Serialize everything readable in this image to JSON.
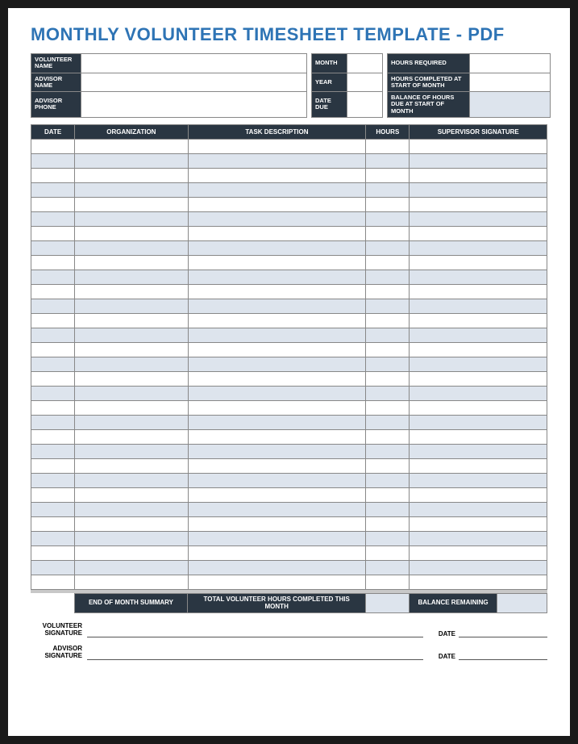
{
  "title": "MONTHLY VOLUNTEER TIMESHEET TEMPLATE - PDF",
  "header": {
    "volunteer_name_label": "VOLUNTEER NAME",
    "advisor_name_label": "ADVISOR NAME",
    "advisor_phone_label": "ADVISOR PHONE",
    "month_label": "MONTH",
    "year_label": "YEAR",
    "date_due_label": "DATE DUE",
    "hours_required_label": "HOURS REQUIRED",
    "hours_completed_label": "HOURS COMPLETED AT START OF MONTH",
    "balance_due_label": "BALANCE OF HOURS DUE AT START OF MONTH",
    "volunteer_name": "",
    "advisor_name": "",
    "advisor_phone": "",
    "month": "",
    "year": "",
    "date_due": "",
    "hours_required": "",
    "hours_completed": "",
    "balance_due": ""
  },
  "columns": {
    "date": "DATE",
    "organization": "ORGANIZATION",
    "task": "TASK DESCRIPTION",
    "hours": "HOURS",
    "signature": "SUPERVISOR SIGNATURE"
  },
  "rows": [
    {
      "date": "",
      "organization": "",
      "task": "",
      "hours": "",
      "signature": ""
    },
    {
      "date": "",
      "organization": "",
      "task": "",
      "hours": "",
      "signature": ""
    },
    {
      "date": "",
      "organization": "",
      "task": "",
      "hours": "",
      "signature": ""
    },
    {
      "date": "",
      "organization": "",
      "task": "",
      "hours": "",
      "signature": ""
    },
    {
      "date": "",
      "organization": "",
      "task": "",
      "hours": "",
      "signature": ""
    },
    {
      "date": "",
      "organization": "",
      "task": "",
      "hours": "",
      "signature": ""
    },
    {
      "date": "",
      "organization": "",
      "task": "",
      "hours": "",
      "signature": ""
    },
    {
      "date": "",
      "organization": "",
      "task": "",
      "hours": "",
      "signature": ""
    },
    {
      "date": "",
      "organization": "",
      "task": "",
      "hours": "",
      "signature": ""
    },
    {
      "date": "",
      "organization": "",
      "task": "",
      "hours": "",
      "signature": ""
    },
    {
      "date": "",
      "organization": "",
      "task": "",
      "hours": "",
      "signature": ""
    },
    {
      "date": "",
      "organization": "",
      "task": "",
      "hours": "",
      "signature": ""
    },
    {
      "date": "",
      "organization": "",
      "task": "",
      "hours": "",
      "signature": ""
    },
    {
      "date": "",
      "organization": "",
      "task": "",
      "hours": "",
      "signature": ""
    },
    {
      "date": "",
      "organization": "",
      "task": "",
      "hours": "",
      "signature": ""
    },
    {
      "date": "",
      "organization": "",
      "task": "",
      "hours": "",
      "signature": ""
    },
    {
      "date": "",
      "organization": "",
      "task": "",
      "hours": "",
      "signature": ""
    },
    {
      "date": "",
      "organization": "",
      "task": "",
      "hours": "",
      "signature": ""
    },
    {
      "date": "",
      "organization": "",
      "task": "",
      "hours": "",
      "signature": ""
    },
    {
      "date": "",
      "organization": "",
      "task": "",
      "hours": "",
      "signature": ""
    },
    {
      "date": "",
      "organization": "",
      "task": "",
      "hours": "",
      "signature": ""
    },
    {
      "date": "",
      "organization": "",
      "task": "",
      "hours": "",
      "signature": ""
    },
    {
      "date": "",
      "organization": "",
      "task": "",
      "hours": "",
      "signature": ""
    },
    {
      "date": "",
      "organization": "",
      "task": "",
      "hours": "",
      "signature": ""
    },
    {
      "date": "",
      "organization": "",
      "task": "",
      "hours": "",
      "signature": ""
    },
    {
      "date": "",
      "organization": "",
      "task": "",
      "hours": "",
      "signature": ""
    },
    {
      "date": "",
      "organization": "",
      "task": "",
      "hours": "",
      "signature": ""
    },
    {
      "date": "",
      "organization": "",
      "task": "",
      "hours": "",
      "signature": ""
    },
    {
      "date": "",
      "organization": "",
      "task": "",
      "hours": "",
      "signature": ""
    },
    {
      "date": "",
      "organization": "",
      "task": "",
      "hours": "",
      "signature": ""
    },
    {
      "date": "",
      "organization": "",
      "task": "",
      "hours": "",
      "signature": ""
    }
  ],
  "summary": {
    "end_of_month_label": "END OF MONTH SUMMARY",
    "total_hours_label": "TOTAL VOLUNTEER HOURS COMPLETED THIS MONTH",
    "balance_remaining_label": "BALANCE REMAINING",
    "total_hours": "",
    "balance_remaining": ""
  },
  "signature": {
    "volunteer_sig_label": "VOLUNTEER SIGNATURE",
    "advisor_sig_label": "ADVISOR SIGNATURE",
    "date_label": "DATE"
  }
}
